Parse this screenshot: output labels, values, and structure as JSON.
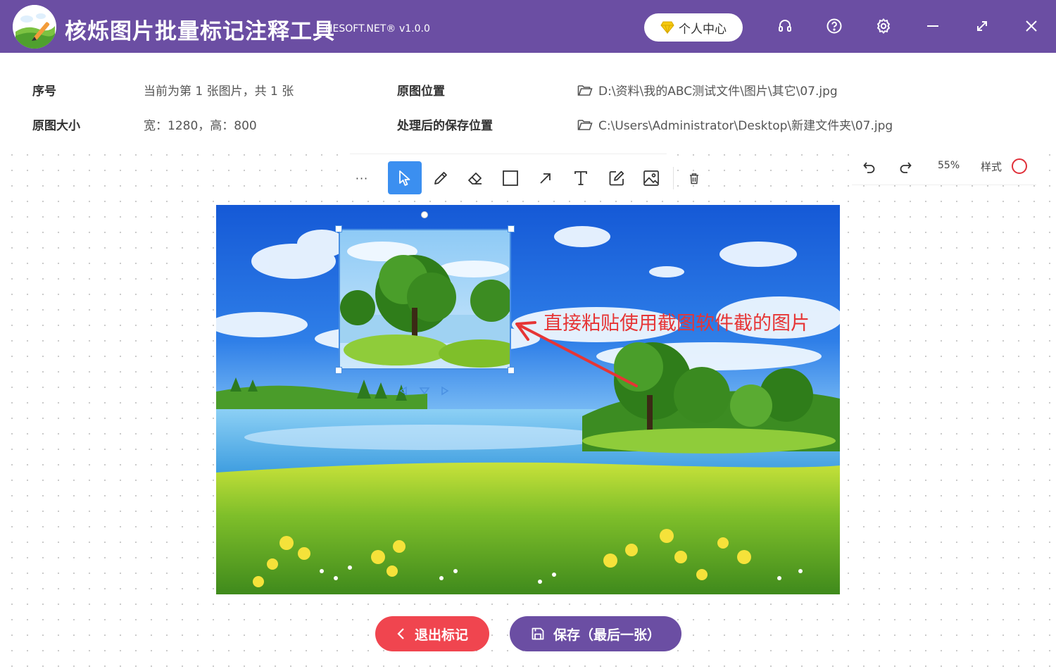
{
  "app": {
    "title": "核烁图片批量标记注释工具",
    "brand": "HESOFT.NET®",
    "version": "v1.0.0",
    "user_center": "个人中心",
    "icons": [
      "headset-icon",
      "help-icon",
      "settings-icon",
      "minimize-icon",
      "maximize-icon",
      "close-icon"
    ]
  },
  "info": {
    "index_label": "序号",
    "index_value": "当前为第 1 张图片，共 1 张",
    "source_label": "原图位置",
    "source_path": "D:\\资料\\我的ABC测试文件\\图片\\其它\\07.jpg",
    "size_label": "原图大小",
    "size_value": "宽：1280，高：800",
    "save_label": "处理后的保存位置",
    "save_path": "C:\\Users\\Administrator\\Desktop\\新建文件夹\\07.jpg"
  },
  "toolbar": {
    "more": "···",
    "tools": [
      "select-tool",
      "pen-tool",
      "eraser-tool",
      "rectangle-tool",
      "arrow-tool",
      "text-tool",
      "edit-tool",
      "image-tool",
      "delete-tool"
    ],
    "active_tool": "select-tool"
  },
  "right_panel": {
    "zoom": "55%",
    "style_label": "样式",
    "style_color": "#e0303a"
  },
  "annotation": {
    "text": "直接粘贴使用截图软件截的图片",
    "color": "#e63535"
  },
  "buttons": {
    "exit": "退出标记",
    "save": "保存（最后一张）"
  },
  "colors": {
    "brand": "#6b4ea3",
    "exit": "#f0454f",
    "accent": "#3b8ff0"
  }
}
